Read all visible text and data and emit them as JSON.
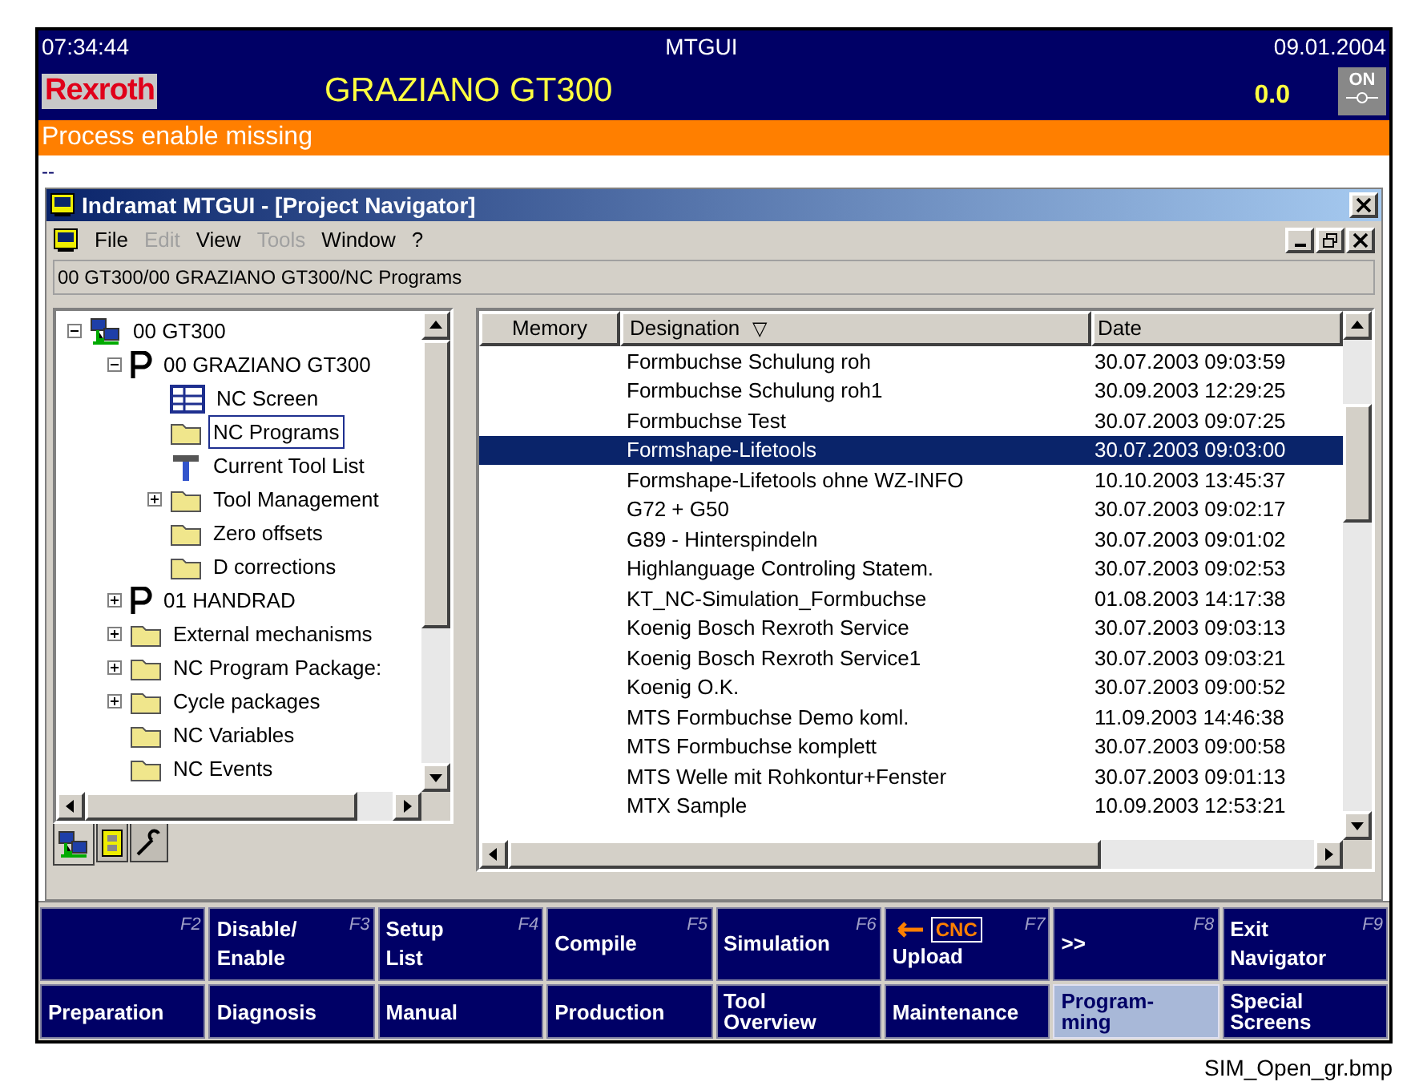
{
  "header": {
    "time": "07:34:44",
    "app": "MTGUI",
    "date": "09.01.2004",
    "logo": "Rexroth",
    "machine": "GRAZIANO GT300",
    "value": "0.0",
    "on_label": "ON"
  },
  "message": "Process enable missing",
  "info_line": "--",
  "window": {
    "title": "Indramat MTGUI - [Project Navigator]",
    "menu": [
      {
        "label": "File",
        "disabled": false
      },
      {
        "label": "Edit",
        "disabled": true
      },
      {
        "label": "View",
        "disabled": false
      },
      {
        "label": "Tools",
        "disabled": true
      },
      {
        "label": "Window",
        "disabled": false
      },
      {
        "label": "?",
        "disabled": false
      }
    ],
    "path": "00 GT300/00 GRAZIANO GT300/NC Programs"
  },
  "tree": [
    {
      "label": "00 GT300",
      "kind": "network",
      "expanded": true,
      "selected": false,
      "children": [
        {
          "label": "00 GRAZIANO GT300",
          "kind": "project",
          "expanded": true,
          "selected": false,
          "children": [
            {
              "label": "NC Screen",
              "kind": "screen",
              "selected": false
            },
            {
              "label": "NC Programs",
              "kind": "folder",
              "selected": true
            },
            {
              "label": "Current Tool List",
              "kind": "tool",
              "selected": false
            },
            {
              "label": "Tool Management",
              "kind": "folder",
              "expanded": false,
              "selected": false
            },
            {
              "label": "Zero offsets",
              "kind": "folder",
              "selected": false
            },
            {
              "label": "D corrections",
              "kind": "folder",
              "selected": false
            }
          ]
        },
        {
          "label": "01 HANDRAD",
          "kind": "project",
          "expanded": false,
          "selected": false
        },
        {
          "label": "External mechanisms",
          "kind": "folder",
          "expanded": false,
          "selected": false
        },
        {
          "label": "NC Program Package:",
          "kind": "folder",
          "expanded": false,
          "selected": false
        },
        {
          "label": "Cycle packages",
          "kind": "folder",
          "expanded": false,
          "selected": false
        },
        {
          "label": "NC Variables",
          "kind": "folder",
          "selected": false
        },
        {
          "label": "NC Events",
          "kind": "folder",
          "selected": false
        }
      ]
    }
  ],
  "tree_tabs": [
    {
      "kind": "network",
      "selected": true
    },
    {
      "kind": "panel",
      "selected": false
    },
    {
      "kind": "wrench",
      "selected": false
    }
  ],
  "table": {
    "columns": [
      {
        "label": "Memory"
      },
      {
        "label": "Designation",
        "sort": "▽"
      },
      {
        "label": "Date"
      }
    ],
    "rows": [
      {
        "designation": "Formbuchse Schulung roh",
        "date": "30.07.2003 09:03:59",
        "selected": false
      },
      {
        "designation": "Formbuchse Schulung roh1",
        "date": "30.09.2003 12:29:25",
        "selected": false
      },
      {
        "designation": "Formbuchse Test",
        "date": "30.07.2003 09:07:25",
        "selected": false
      },
      {
        "designation": "Formshape-Lifetools",
        "date": "30.07.2003 09:03:00",
        "selected": true
      },
      {
        "designation": "Formshape-Lifetools ohne WZ-INFO",
        "date": "10.10.2003 13:45:37",
        "selected": false
      },
      {
        "designation": "G72 + G50",
        "date": "30.07.2003 09:02:17",
        "selected": false
      },
      {
        "designation": "G89 - Hinterspindeln",
        "date": "30.07.2003 09:01:02",
        "selected": false
      },
      {
        "designation": "Highlanguage Controling Statem.",
        "date": "30.07.2003 09:02:53",
        "selected": false
      },
      {
        "designation": "KT_NC-Simulation_Formbuchse",
        "date": "01.08.2003 14:17:38",
        "selected": false
      },
      {
        "designation": "Koenig Bosch Rexroth Service",
        "date": "30.07.2003 09:03:13",
        "selected": false
      },
      {
        "designation": "Koenig Bosch Rexroth Service1",
        "date": "30.07.2003 09:03:21",
        "selected": false
      },
      {
        "designation": "Koenig O.K.",
        "date": "30.07.2003 09:00:52",
        "selected": false
      },
      {
        "designation": "MTS Formbuchse Demo koml.",
        "date": "11.09.2003 14:46:38",
        "selected": false
      },
      {
        "designation": "MTS Formbuchse komplett",
        "date": "30.07.2003 09:00:58",
        "selected": false
      },
      {
        "designation": "MTS Welle mit Rohkontur+Fenster",
        "date": "30.07.2003 09:01:13",
        "selected": false
      },
      {
        "designation": "MTX Sample",
        "date": "10.09.2003 12:53:21",
        "selected": false
      }
    ]
  },
  "softkeys": [
    {
      "key": "F2",
      "kind": "plain"
    },
    {
      "key": "F3",
      "kind": "plain",
      "lines": [
        "Disable/",
        "Enable"
      ]
    },
    {
      "key": "F4",
      "kind": "plain",
      "lines": [
        "Setup",
        "List"
      ]
    },
    {
      "key": "F5",
      "kind": "plain",
      "lines": [
        "Compile"
      ]
    },
    {
      "key": "F6",
      "kind": "plain",
      "lines": [
        "Simulation"
      ]
    },
    {
      "key": "F7",
      "kind": "upload",
      "badge": "CNC",
      "lines": [
        "Upload"
      ]
    },
    {
      "key": "F8",
      "kind": "plain",
      "lines": [
        ">>"
      ]
    },
    {
      "key": "F9",
      "kind": "plain",
      "lines": [
        "Exit",
        "Navigator"
      ]
    }
  ],
  "areas": [
    {
      "lines": [
        "Preparation"
      ],
      "selected": false
    },
    {
      "lines": [
        "Diagnosis"
      ],
      "selected": false
    },
    {
      "lines": [
        "Manual"
      ],
      "selected": false
    },
    {
      "lines": [
        "Production"
      ],
      "selected": false
    },
    {
      "lines": [
        "Tool",
        "Overview"
      ],
      "selected": false
    },
    {
      "lines": [
        "Maintenance"
      ],
      "selected": false
    },
    {
      "lines": [
        "Program-",
        "ming"
      ],
      "selected": true
    },
    {
      "lines": [
        "Special",
        "Screens"
      ],
      "selected": false
    }
  ],
  "caption": "SIM_Open_gr.bmp"
}
